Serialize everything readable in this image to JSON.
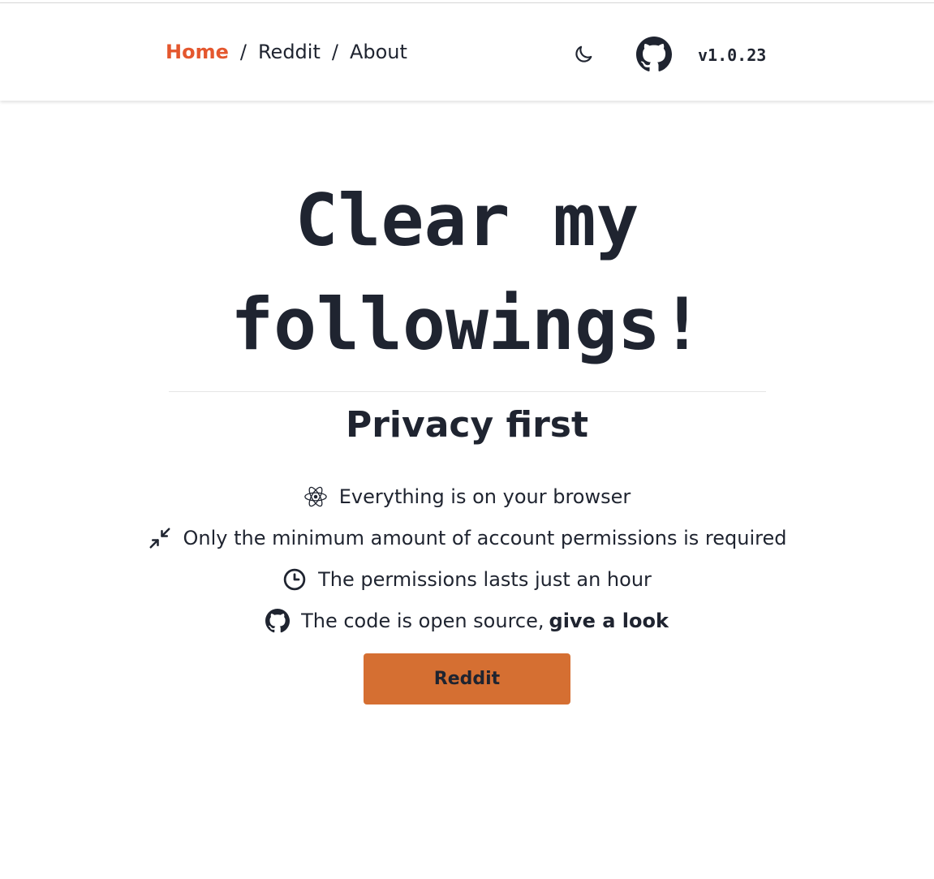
{
  "header": {
    "breadcrumb": [
      {
        "label": "Home",
        "active": true
      },
      {
        "label": "Reddit",
        "active": false
      },
      {
        "label": "About",
        "active": false
      }
    ],
    "separator": "/",
    "version": "v1.0.23",
    "theme_icon": "moon-icon",
    "repo_icon": "github-icon"
  },
  "hero": {
    "title_line1": "Clear my",
    "title_line2": "followings!",
    "subtitle": "Privacy first"
  },
  "features": [
    {
      "icon": "react-atom-icon",
      "text": "Everything is on your browser"
    },
    {
      "icon": "compress-arrows-icon",
      "text": "Only the minimum amount of account permissions is required"
    },
    {
      "icon": "clock-icon",
      "text": "The permissions lasts just an hour"
    },
    {
      "icon": "github-icon",
      "text": "The code is open source,",
      "link_text": "give a look"
    }
  ],
  "cta": {
    "label": "Reddit"
  },
  "colors": {
    "accent": "#e4572e",
    "button": "#d56f32",
    "text": "#1f2430"
  }
}
